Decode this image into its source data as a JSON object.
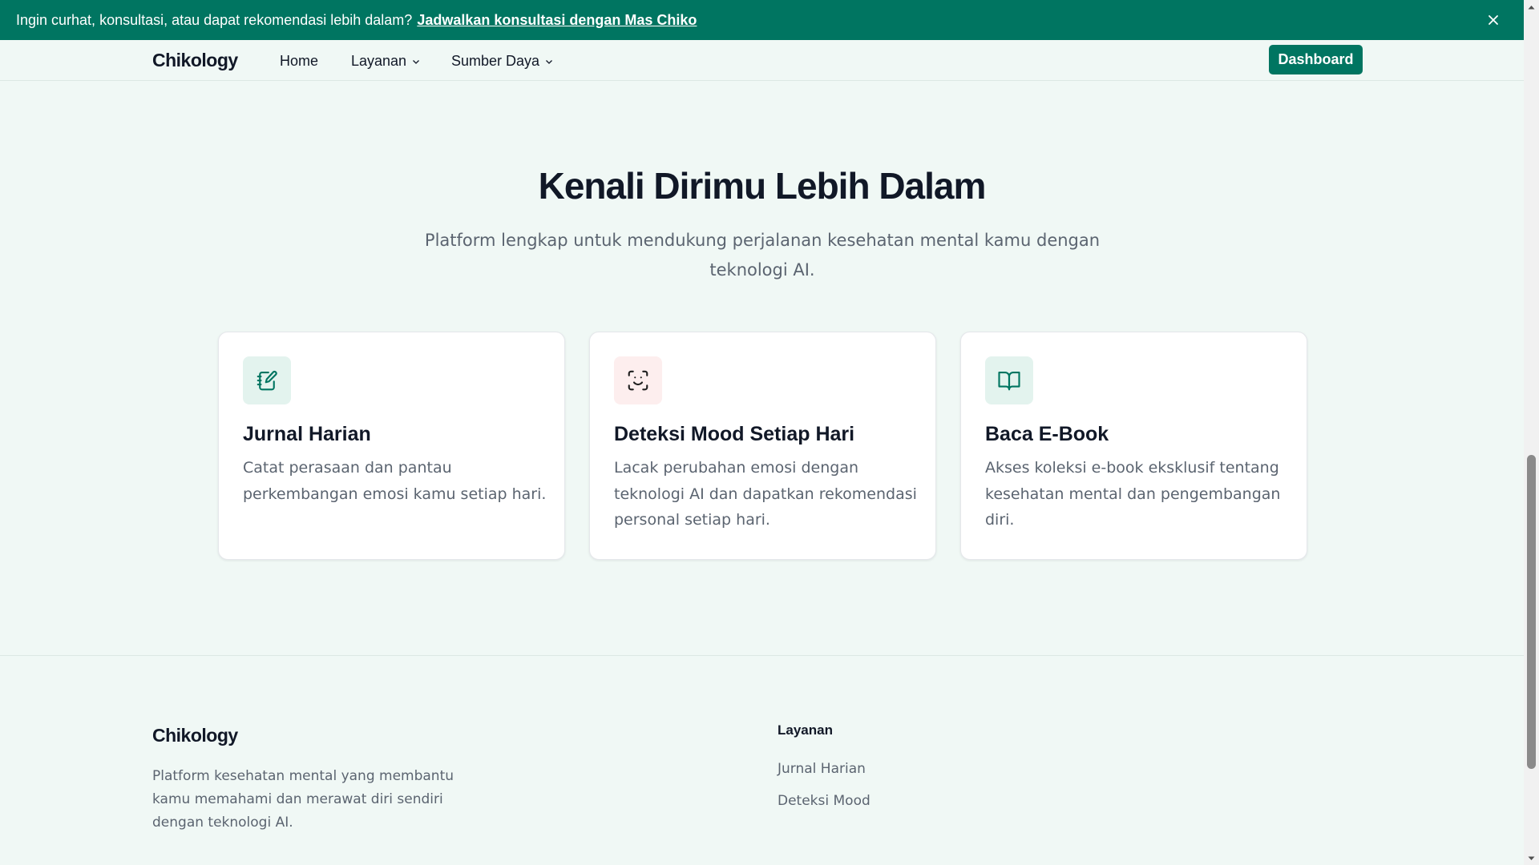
{
  "banner": {
    "text": "Ingin curhat, konsultasi, atau dapat rekomendasi lebih dalam?",
    "link": "Jadwalkan konsultasi dengan Mas Chiko",
    "close_icon": "close-icon"
  },
  "nav": {
    "brand": "Chikology",
    "items": [
      {
        "label": "Home"
      },
      {
        "label": "Layanan",
        "icon": "chevron-down-icon"
      },
      {
        "label": "Sumber Daya",
        "icon": "chevron-down-icon"
      }
    ],
    "dashboard_label": "Dashboard"
  },
  "hero": {
    "title": "Kenali Dirimu Lebih Dalam",
    "subtitle": "Platform lengkap untuk mendukung perjalanan kesehatan mental kamu dengan teknologi AI."
  },
  "features": [
    {
      "icon": "journal-edit-icon",
      "title": "Jurnal Harian",
      "desc": "Catat perasaan dan pantau perkembangan emosi kamu setiap hari."
    },
    {
      "icon": "face-scan-icon",
      "title": "Deteksi Mood Setiap Hari",
      "desc": "Lacak perubahan emosi dengan teknologi AI dan dapatkan rekomendasi personal setiap hari."
    },
    {
      "icon": "open-book-icon",
      "title": "Baca E-Book",
      "desc": "Akses koleksi e-book eksklusif tentang kesehatan mental dan pengembangan diri."
    }
  ],
  "footer": {
    "brand": "Chikology",
    "desc": "Platform kesehatan mental yang membantu kamu memahami dan merawat diri sendiri dengan teknologi AI.",
    "services_heading": "Layanan",
    "services_links": [
      "Jurnal Harian",
      "Deteksi Mood"
    ]
  },
  "colors": {
    "primary": "#007561",
    "background": "#f0f8f5",
    "text": "#111827",
    "muted": "#5b6470",
    "journal_icon_bg": "#e3f3ee",
    "mood_icon_bg": "#fdeeee",
    "book_icon_bg": "#e3f3ee"
  }
}
